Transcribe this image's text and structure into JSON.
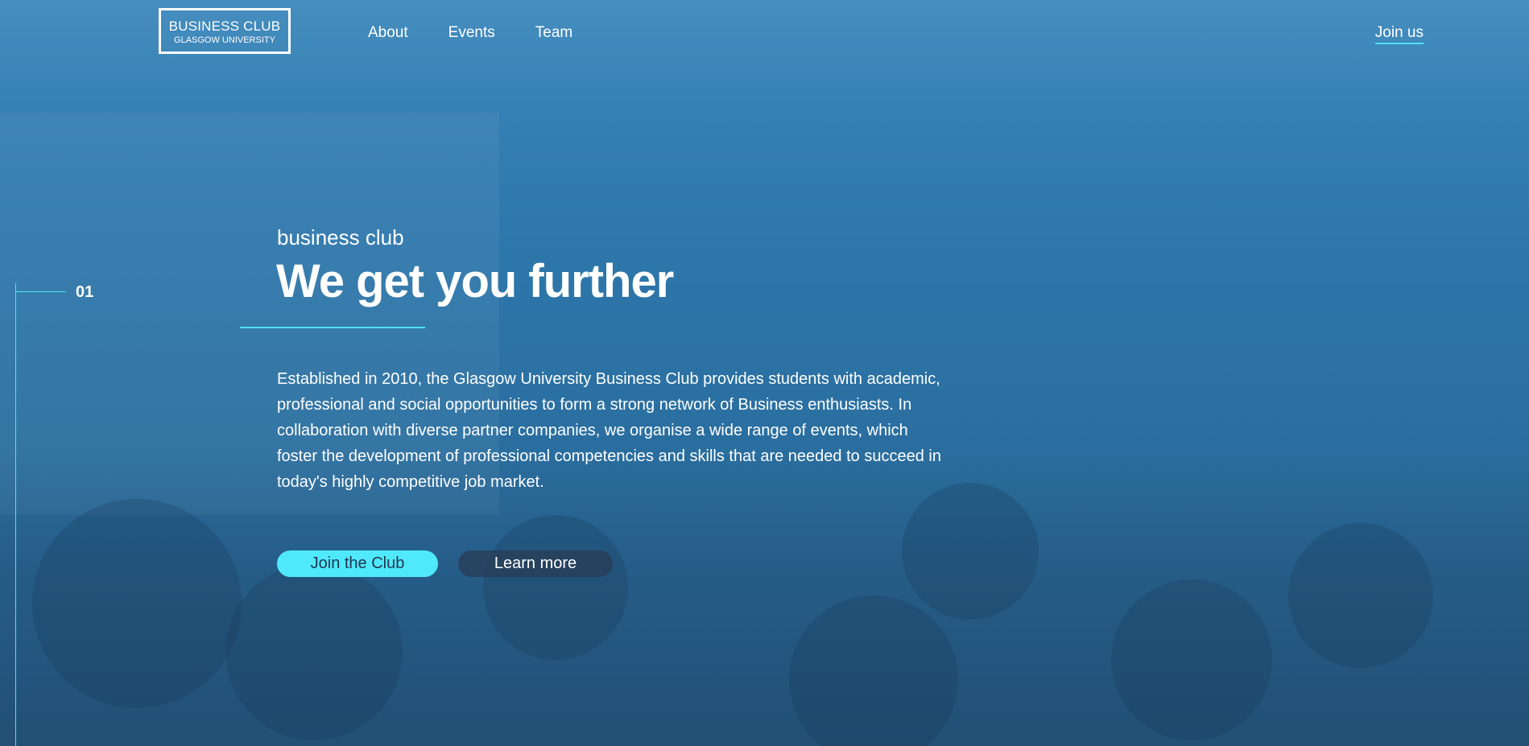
{
  "header": {
    "logo": {
      "title": "BUSINESS CLUB",
      "subtitle": "GLASGOW UNIVERSITY"
    },
    "nav": [
      {
        "label": "About"
      },
      {
        "label": "Events"
      },
      {
        "label": "Team"
      }
    ],
    "join_link": "Join us"
  },
  "hero": {
    "slide_number": "01",
    "eyebrow": "business club",
    "headline": "We get you further",
    "description": "Established in 2010, the Glasgow University Business Club provides students with academic, professional and social opportunities to form a strong network of Business enthusiasts. In collaboration with diverse partner companies, we organise a wide range of events, which foster the development of professional competencies and skills that are needed to succeed in today's highly competitive job market.",
    "primary_button": "Join the Club",
    "secondary_button": "Learn more"
  },
  "colors": {
    "accent": "#4fe3f5",
    "background": "#2e78ac",
    "secondary_button": "#283c55"
  }
}
